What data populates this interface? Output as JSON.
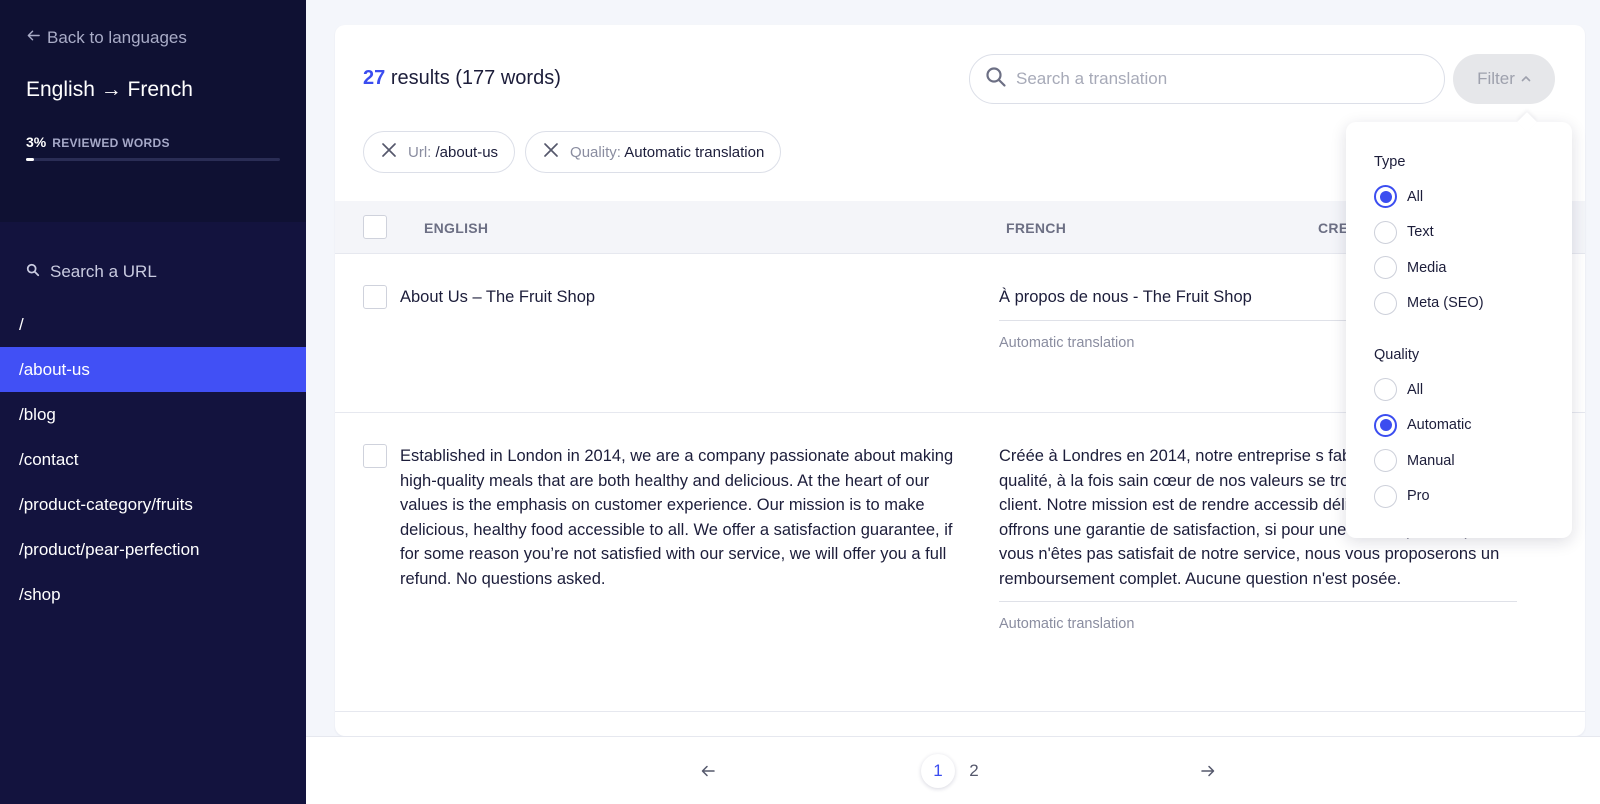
{
  "sidebar": {
    "back_label": "Back to languages",
    "language_pair": "English → French",
    "progress": {
      "percent_label": "3%",
      "label": "REVIEWED WORDS",
      "fraction": 0.03
    },
    "url_search_placeholder": "Search a URL",
    "urls": [
      {
        "label": "/",
        "active": false
      },
      {
        "label": "/about-us",
        "active": true
      },
      {
        "label": "/blog",
        "active": false
      },
      {
        "label": "/contact",
        "active": false
      },
      {
        "label": "/product-category/fruits",
        "active": false
      },
      {
        "label": "/product/pear-perfection",
        "active": false
      },
      {
        "label": "/shop",
        "active": false
      }
    ]
  },
  "main": {
    "results_count": "27",
    "results_suffix": "results (177 words)",
    "search_placeholder": "Search a translation",
    "filter_label": "Filter",
    "chips": [
      {
        "key": "Url:",
        "value": "/about-us"
      },
      {
        "key": "Quality:",
        "value": "Automatic translation"
      }
    ],
    "columns": {
      "source": "ENGLISH",
      "target": "FRENCH",
      "third": "CRE"
    },
    "rows": [
      {
        "source": "About Us – The Fruit Shop",
        "target": "À propos de nous - The Fruit Shop",
        "quality": "Automatic translation"
      },
      {
        "source": "Established in London in 2014, we are a company passionate about making high-quality meals that are both healthy and delicious. At the heart of our values is the emphasis on customer experience. Our mission is to make delicious, healthy food accessible to all.  We offer a satisfaction guarantee, if for some reason you’re not satisfied with our service, we will offer you a full refund. No questions asked.",
        "target": "Créée à Londres en 2014, notre entreprise s fabrication de repas de qualité, à la fois sain cœur de nos valeurs se trouve l'accent mis s client. Notre mission est de rendre accessib délicieux et sains. Nous offrons une garantie de satisfaction, si pour une raison quelconque vous n'êtes pas satisfait de notre service, nous vous proposerons un remboursement complet. Aucune question n'est posée.",
        "quality": "Automatic translation"
      }
    ]
  },
  "filter_dropdown": {
    "type_title": "Type",
    "type_options": [
      "All",
      "Text",
      "Media",
      "Meta (SEO)"
    ],
    "type_selected": "All",
    "quality_title": "Quality",
    "quality_options": [
      "All",
      "Automatic",
      "Manual",
      "Pro"
    ],
    "quality_selected": "Automatic"
  },
  "pagination": {
    "pages": [
      "1",
      "2"
    ],
    "current": "1"
  },
  "colors": {
    "accent": "#3b4df0",
    "sidebar_bg": "#13133e",
    "sidebar_top_bg": "#0f1133",
    "active_item": "#4150f5"
  },
  "icons": [
    "arrow-left-icon",
    "search-icon",
    "chevron-up-icon",
    "close-icon",
    "arrow-right-icon"
  ]
}
